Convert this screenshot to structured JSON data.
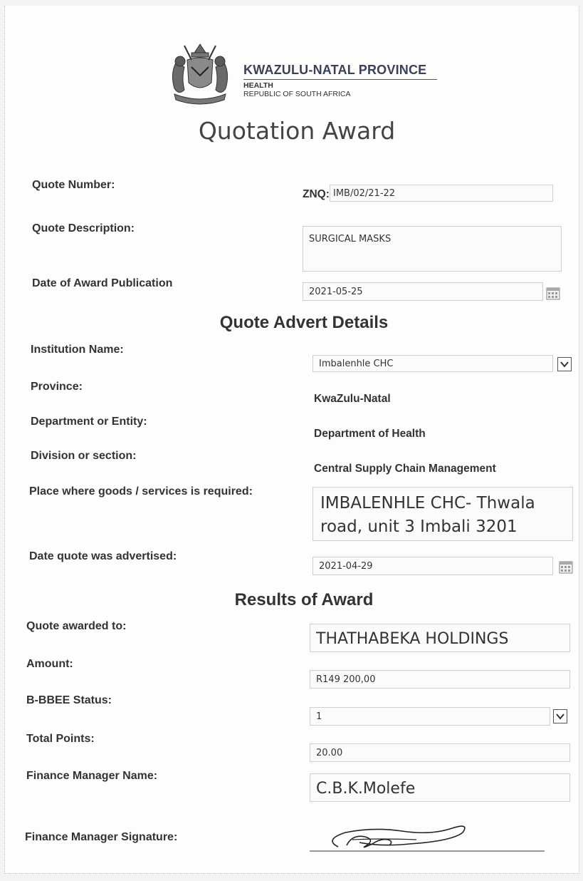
{
  "header": {
    "province": "KWAZULU-NATAL PROVINCE",
    "department": "HEALTH",
    "country": "REPUBLIC OF SOUTH AFRICA",
    "title": "Quotation Award"
  },
  "quote": {
    "number_label": "Quote Number:",
    "number_prefix": "ZNQ:",
    "number_value": "IMB/02/21-22",
    "description_label": "Quote Description:",
    "description_value": "SURGICAL MASKS",
    "award_date_label": "Date of Award Publication",
    "award_date_value": "2021-05-25"
  },
  "advert": {
    "heading": "Quote Advert Details",
    "institution_label": "Institution Name:",
    "institution_value": "Imbalenhle CHC",
    "province_label": "Province:",
    "province_value": "KwaZulu-Natal",
    "department_label": "Department or Entity:",
    "department_value": "Department of Health",
    "division_label": "Division or section:",
    "division_value": "Central Supply Chain Management",
    "place_label": "Place where goods /  services is required:",
    "place_value": "IMBALENHLE CHC- Thwala road, unit 3 Imbali 3201",
    "advertised_label": "Date quote was advertised:",
    "advertised_value": "2021-04-29"
  },
  "results": {
    "heading": "Results of Award",
    "awarded_label": "Quote awarded to:",
    "awarded_value": "THATHABEKA HOLDINGS",
    "amount_label": "Amount:",
    "amount_value": "R149 200,00",
    "bbbee_label": "B-BBEE Status:",
    "bbbee_value": "1",
    "points_label": "Total Points:",
    "points_value": "20.00",
    "manager_label": "Finance Manager Name:",
    "manager_value": "C.B.K.Molefe",
    "signature_label": "Finance Manager Signature:"
  },
  "icons": {
    "coat_of_arms": "coat-of-arms-icon",
    "calendar": "calendar-icon",
    "dropdown": "chevron-down-icon"
  },
  "colors": {
    "province_text": "#3a3f5c"
  }
}
